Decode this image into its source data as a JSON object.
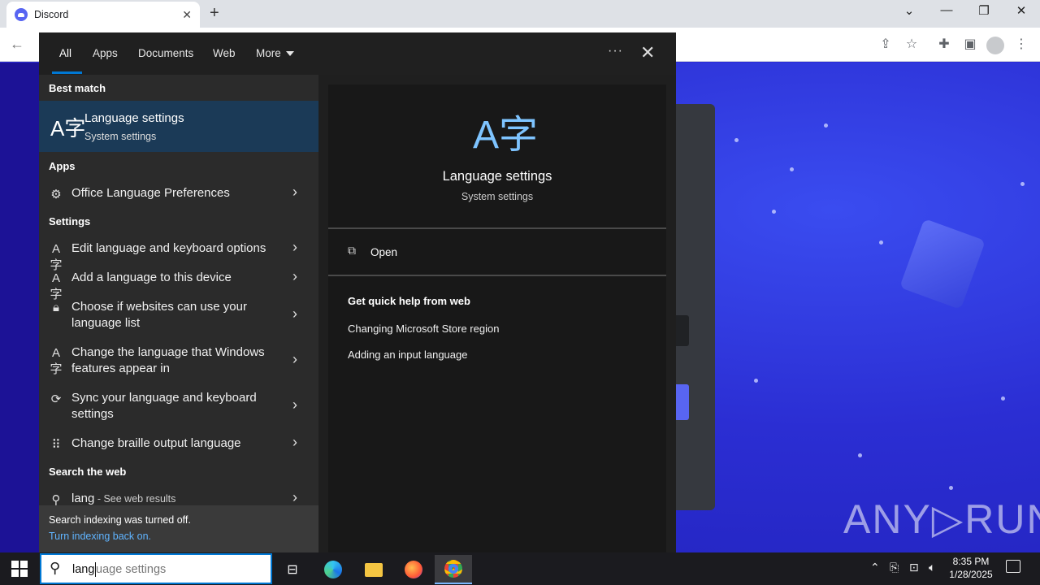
{
  "browser": {
    "tab_title": "Discord",
    "tab_close": "✕",
    "new_tab": "+",
    "controls": {
      "chevron": "⌄",
      "minimize": "—",
      "restore": "❐",
      "close": "✕"
    }
  },
  "search_panel": {
    "filters": [
      {
        "label": "All",
        "active": true
      },
      {
        "label": "Apps"
      },
      {
        "label": "Documents"
      },
      {
        "label": "Web"
      },
      {
        "label": "More"
      }
    ],
    "options_dots": "···",
    "close": "✕",
    "sections": {
      "best_match": "Best match",
      "apps": "Apps",
      "settings": "Settings",
      "search_web": "Search the web"
    },
    "best_match": {
      "icon": "language-icon",
      "title": "Language settings",
      "subtitle": "System settings"
    },
    "apps": [
      {
        "icon": "office-language-icon",
        "label": "Office Language Preferences"
      }
    ],
    "settings": [
      {
        "icon": "language-icon",
        "label": "Edit language and keyboard options"
      },
      {
        "icon": "language-icon",
        "label": "Add a language to this device"
      },
      {
        "icon": "lock-icon",
        "label": "Choose if websites can use your language list"
      },
      {
        "icon": "language-icon",
        "label": "Change the language that Windows features appear in"
      },
      {
        "icon": "sync-icon",
        "label": "Sync your language and keyboard settings"
      },
      {
        "icon": "braille-icon",
        "label": "Change braille output language"
      }
    ],
    "web": {
      "query": "lang",
      "suffix": " - See web results"
    },
    "index_notice": {
      "line1": "Search indexing was turned off.",
      "link": "Turn indexing back on."
    },
    "detail": {
      "title": "Language settings",
      "subtitle": "System settings",
      "open_label": "Open",
      "quick_help_heading": "Get quick help from web",
      "links": [
        "Changing Microsoft Store region",
        "Adding an input language"
      ]
    }
  },
  "watermark": "ANY▷RUN",
  "taskbar": {
    "search_typed": "lang",
    "search_hint": "uage settings",
    "time": "8:35 PM",
    "date": "1/28/2025"
  }
}
